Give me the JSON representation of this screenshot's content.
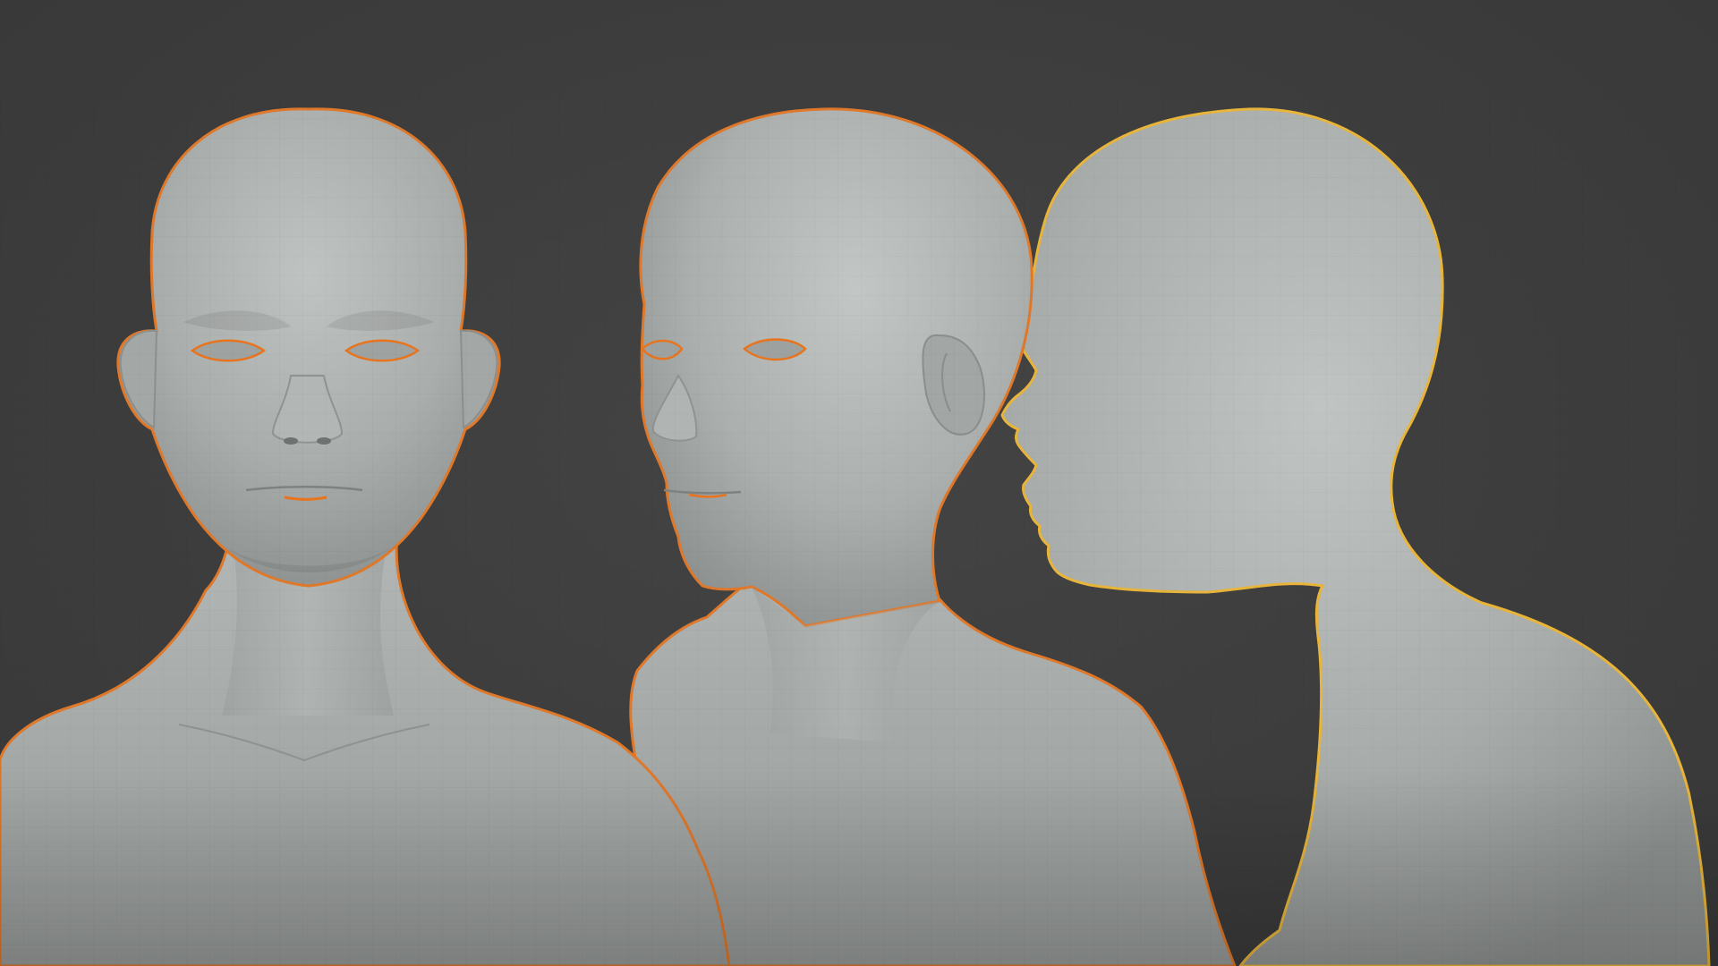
{
  "viewport": {
    "background_color": "#3d3d3d",
    "mesh_color": "#a9adab",
    "selection_outline_front": "#e0782a",
    "selection_outline_threequarter": "#e0782a",
    "selection_outline_profile": "#e8b53a",
    "inner_loop_color": "#e8741e"
  },
  "models": [
    {
      "view": "front",
      "icon": "head-bust-mesh-icon",
      "selected": true
    },
    {
      "view": "three-quarter",
      "icon": "head-bust-mesh-icon",
      "selected": true
    },
    {
      "view": "profile",
      "icon": "head-bust-mesh-icon",
      "selected": true,
      "active": true
    }
  ]
}
